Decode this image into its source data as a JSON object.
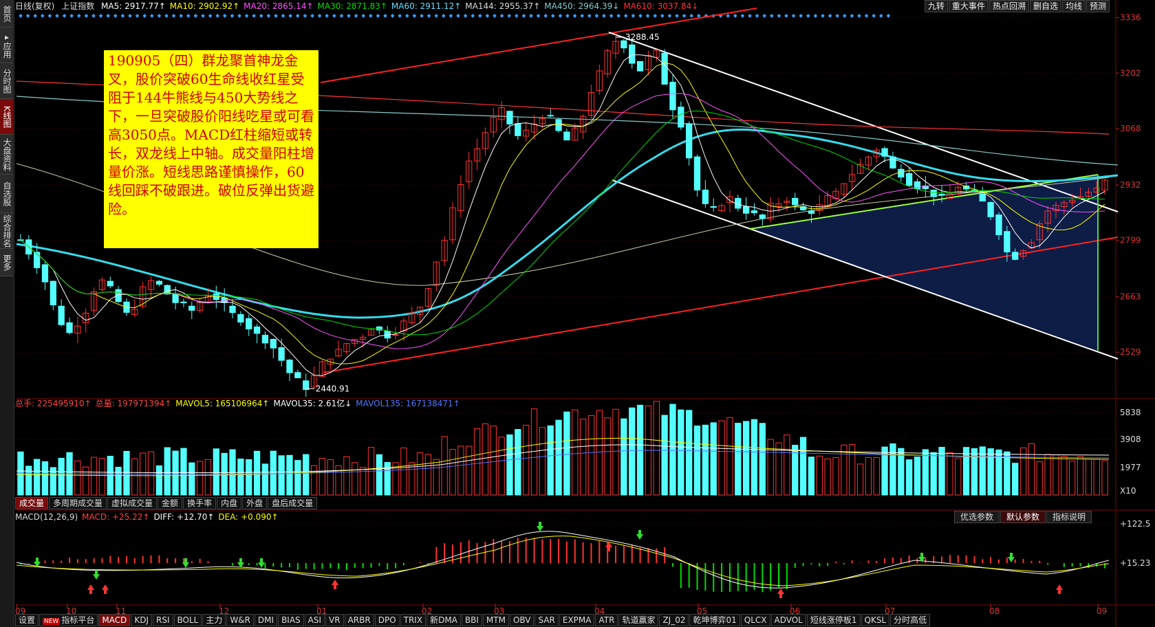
{
  "left_tabs": [
    {
      "label": "首页",
      "active": false
    },
    {
      "label": "▸应用",
      "active": false
    },
    {
      "label": "分时图",
      "active": false
    },
    {
      "label": "K线图",
      "active": true
    },
    {
      "label": "大盘资料",
      "active": false
    },
    {
      "label": "自选股",
      "active": false
    },
    {
      "label": "综合排名",
      "active": false
    },
    {
      "label": "更多",
      "active": false
    }
  ],
  "header": {
    "period": "日线(复权)",
    "index_name": "上证指数",
    "ma": [
      {
        "text": "MA5: 2917.77↑",
        "color": "#ffffff"
      },
      {
        "text": "MA10: 2902.92↑",
        "color": "#ffff00"
      },
      {
        "text": "MA20: 2865.14↑",
        "color": "#ff55ff"
      },
      {
        "text": "MA30: 2871.83↑",
        "color": "#00dd00"
      },
      {
        "text": "MA60: 2911.12↑",
        "color": "#66ddff"
      },
      {
        "text": "MA144: 2955.37↑",
        "color": "#dddddd"
      },
      {
        "text": "MA450: 2964.39↓",
        "color": "#88cccc"
      },
      {
        "text": "MA610: 3037.84↓",
        "color": "#ff3333"
      }
    ]
  },
  "right_buttons": [
    "九转",
    "重大事件",
    "热点回溯",
    "删自选",
    "均线",
    "预测"
  ],
  "annotation": "190905（四）群龙聚首神龙金叉，股价突破60生命线收红星受阻于144牛熊线与450大势线之下，一旦突破股价阳线吃星或可看高3050点。MACD红柱缩短或转长，双龙线上中轴。成交量阳柱增量价涨。短线思路谨慎操作，60线回踩不破跟进。破位反弹出货避险。",
  "volume_header": [
    {
      "text": "总手: 225495910↑",
      "color": "#ff4444"
    },
    {
      "text": "总量: 197971394↑",
      "color": "#ff4444"
    },
    {
      "text": "MAVOL5: 165106964↑",
      "color": "#ffff00"
    },
    {
      "text": "MAVOL35: 2.61亿↓",
      "color": "#ffffff"
    },
    {
      "text": "MAVOL135: 167138471↑",
      "color": "#5577ff"
    }
  ],
  "volume_tabs": [
    "成交量",
    "多周期成交量",
    "虚拟成交量",
    "金额",
    "换手率",
    "内盘",
    "外盘",
    "盘后成交量"
  ],
  "macd_header": [
    {
      "text": "MACD(12,26,9)",
      "color": "#dddddd"
    },
    {
      "text": "MACD: +25.22↑",
      "color": "#ff4444"
    },
    {
      "text": "DIFF: +12.70↑",
      "color": "#ffffff"
    },
    {
      "text": "DEA: +0.090↑",
      "color": "#ffff00"
    }
  ],
  "macd_buttons": [
    "优选参数",
    "默认参数",
    "指标说明"
  ],
  "bottom_tabs": [
    "设置",
    "指标平台",
    "MACD",
    "KDJ",
    "RSI",
    "BOLL",
    "主力",
    "W&R",
    "DMI",
    "BIAS",
    "ASI",
    "VR",
    "ARBR",
    "DPO",
    "TRIX",
    "新DMA",
    "BBI",
    "MTM",
    "OBV",
    "SAR",
    "EXPMA",
    "ATR",
    "轨道赢家",
    "ZJ_02",
    "乾坤博弈01",
    "QLCX",
    "ADVOL",
    "短线涨停板1",
    "QKSL",
    "分时高低"
  ],
  "chart_data": {
    "type": "candlestick",
    "title": "上证指数 日线(复权)",
    "price_axis": {
      "ticks": [
        3336,
        3202,
        3068,
        2932,
        2799,
        2663,
        2529
      ],
      "range": [
        2420,
        3345
      ]
    },
    "volume_axis": {
      "ticks": [
        "5838",
        "3908",
        "1977"
      ],
      "unit": "X10"
    },
    "macd_axis": {
      "ticks": [
        "+122.5",
        "+15.23"
      ]
    },
    "x_ticks": [
      "09",
      "10",
      "11",
      "12",
      "01",
      "02",
      "03",
      "04",
      "05",
      "06",
      "07",
      "08",
      "09"
    ],
    "high_label": "3288.45",
    "low_label": "2440.91",
    "price_path": [
      2800,
      2770,
      2740,
      2700,
      2640,
      2600,
      2575,
      2600,
      2630,
      2680,
      2700,
      2680,
      2650,
      2620,
      2640,
      2680,
      2700,
      2690,
      2670,
      2650,
      2640,
      2630,
      2650,
      2670,
      2660,
      2640,
      2620,
      2610,
      2590,
      2570,
      2560,
      2540,
      2510,
      2480,
      2460,
      2445,
      2470,
      2500,
      2520,
      2530,
      2550,
      2560,
      2570,
      2590,
      2580,
      2570,
      2580,
      2600,
      2620,
      2640,
      2690,
      2750,
      2800,
      2870,
      2940,
      2990,
      3020,
      3060,
      3090,
      3110,
      3080,
      3050,
      3060,
      3080,
      3100,
      3090,
      3060,
      3040,
      3060,
      3100,
      3160,
      3200,
      3250,
      3280,
      3270,
      3230,
      3210,
      3240,
      3250,
      3180,
      3120,
      3080,
      3000,
      2920,
      2880,
      2870,
      2890,
      2900,
      2880,
      2870,
      2860,
      2850,
      2880,
      2890,
      2900,
      2880,
      2870,
      2870,
      2880,
      2900,
      2910,
      2940,
      2960,
      2980,
      3000,
      3020,
      3000,
      2970,
      2960,
      2940,
      2930,
      2920,
      2910,
      2900,
      2910,
      2930,
      2920,
      2910,
      2890,
      2860,
      2820,
      2770,
      2760,
      2780,
      2800,
      2840,
      2870,
      2880,
      2890,
      2900,
      2905,
      2915,
      2920,
      2940
    ]
  }
}
